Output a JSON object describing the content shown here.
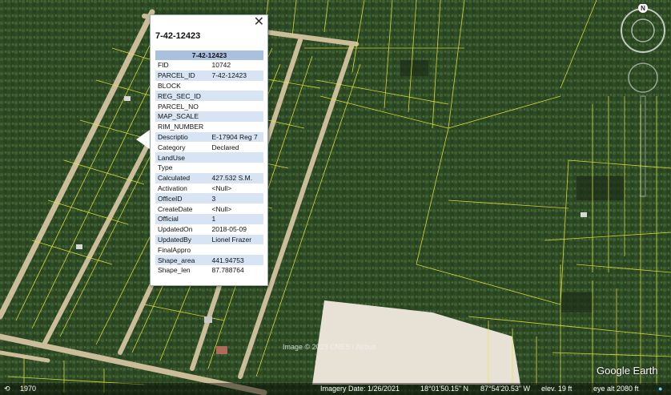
{
  "popup": {
    "title": "7-42-12423",
    "close_label": "✕",
    "header": "7-42-12423",
    "rows": [
      {
        "key": "FID",
        "value": "10742"
      },
      {
        "key": "PARCEL_ID",
        "value": "7-42-12423"
      },
      {
        "key": "BLOCK",
        "value": ""
      },
      {
        "key": "REG_SEC_ID",
        "value": ""
      },
      {
        "key": "PARCEL_NO",
        "value": ""
      },
      {
        "key": "MAP_SCALE",
        "value": ""
      },
      {
        "key": "RIM_NUMBER",
        "value": ""
      },
      {
        "key": "Descriptio",
        "value": "E-17904 Reg 7"
      },
      {
        "key": "Category",
        "value": "Declared"
      },
      {
        "key": "LandUse",
        "value": ""
      },
      {
        "key": "Type",
        "value": ""
      },
      {
        "key": "Calculated",
        "value": "427.532 S.M."
      },
      {
        "key": "Activation",
        "value": "<Null>"
      },
      {
        "key": "OfficeID",
        "value": "3"
      },
      {
        "key": "CreateDate",
        "value": "<Null>"
      },
      {
        "key": "Official",
        "value": "1"
      },
      {
        "key": "UpdatedOn",
        "value": "2018-05-09"
      },
      {
        "key": "UpdatedBy",
        "value": "Lionel Frazer"
      },
      {
        "key": "FinalAppro",
        "value": ""
      },
      {
        "key": "Shape_area",
        "value": "441.94753"
      },
      {
        "key": "Shape_len",
        "value": "87.788764"
      }
    ]
  },
  "map": {
    "attribution": "Image © 2023 CNES / Airbus",
    "logo": "Google Earth",
    "compass_label": "N",
    "year": "1970",
    "status": {
      "imagery_date": "Imagery Date: 1/26/2021",
      "lat": "18°01'50.15\" N",
      "lon": "87°54'20.53\" W",
      "elev": "elev.   19 ft",
      "eye_alt": "eye alt   2080 ft"
    }
  },
  "colors": {
    "vegetation": "#2f4f28",
    "parcel_lines": "#e6e63a",
    "road": "#cbbd9a",
    "clearing": "#e8e2d6"
  }
}
